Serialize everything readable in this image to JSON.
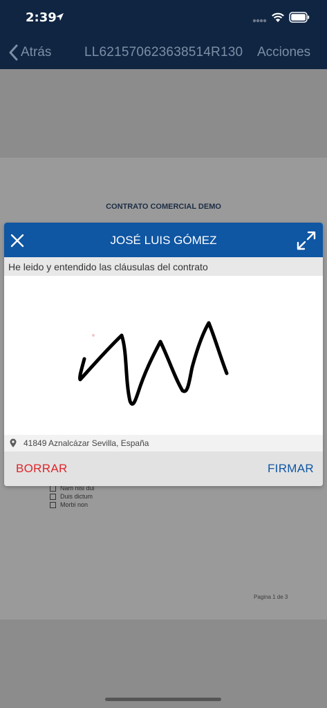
{
  "status_bar": {
    "time": "2:39"
  },
  "nav": {
    "back_label": "Atrás",
    "title": "LL621570623638514R130",
    "actions_label": "Acciones"
  },
  "document": {
    "title": "CONTRATO COMERCIAL DEMO",
    "checklist": [
      "Nam nisi dui",
      "Duis dictum",
      "Morbi non"
    ],
    "page_number": "Pagina 1 de 3"
  },
  "signature_modal": {
    "signer_name": "JOSÉ LUIS GÓMEZ",
    "statement": "He leido y entendido las cláusulas del contrato",
    "location": "41849 Aznalcázar Sevilla, España",
    "clear_label": "BORRAR",
    "sign_label": "FIRMAR",
    "header_color": "#0f56a3",
    "clear_color": "#e0242a",
    "sign_color": "#0f56a3"
  },
  "icons": {
    "back": "chevron-left-icon",
    "close": "close-icon",
    "expand": "expand-icon",
    "location": "map-pin-icon"
  }
}
